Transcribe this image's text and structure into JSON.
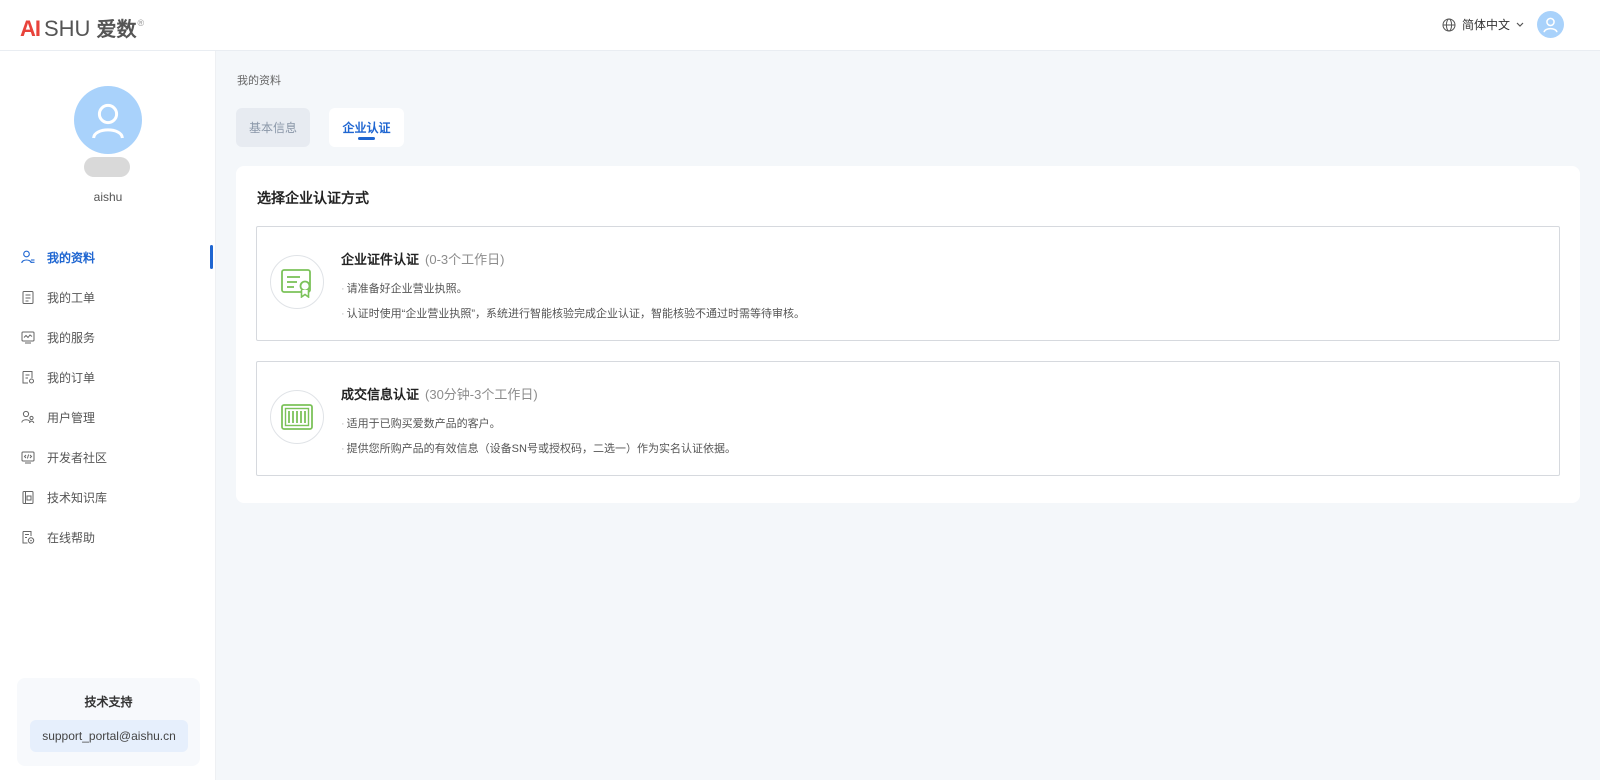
{
  "header": {
    "logo": {
      "ai": "AI",
      "shu": "SHU",
      "cn": "爱数",
      "reg": "®"
    },
    "language": "简体中文"
  },
  "sidebar": {
    "username": "aishu",
    "menu": [
      {
        "label": "我的资料",
        "icon": "user-profile-icon",
        "active": true
      },
      {
        "label": "我的工单",
        "icon": "clipboard-icon",
        "active": false
      },
      {
        "label": "我的服务",
        "icon": "service-monitor-icon",
        "active": false
      },
      {
        "label": "我的订单",
        "icon": "order-document-icon",
        "active": false
      },
      {
        "label": "用户管理",
        "icon": "users-icon",
        "active": false
      },
      {
        "label": "开发者社区",
        "icon": "code-icon",
        "active": false
      },
      {
        "label": "技术知识库",
        "icon": "knowledge-book-icon",
        "active": false
      },
      {
        "label": "在线帮助",
        "icon": "help-document-icon",
        "active": false
      }
    ],
    "support": {
      "title": "技术支持",
      "email": "support_portal@aishu.cn"
    }
  },
  "main": {
    "breadcrumb": "我的资料",
    "tabs": [
      {
        "label": "基本信息",
        "active": false
      },
      {
        "label": "企业认证",
        "active": true
      }
    ],
    "panel_title": "选择企业认证方式",
    "options": [
      {
        "title": "企业证件认证",
        "subtitle": "(0-3个工作日)",
        "icon": "certificate-icon",
        "lines": [
          "请准备好企业营业执照。",
          "认证时使用“企业营业执照”，系统进行智能核验完成企业认证，智能核验不通过时需等待审核。"
        ]
      },
      {
        "title": "成交信息认证",
        "subtitle": "(30分钟-3个工作日)",
        "icon": "barcode-icon",
        "lines": [
          "适用于已购买爱数产品的客户。",
          "提供您所购产品的有效信息（设备SN号或授权码，二选一）作为实名认证依据。"
        ]
      }
    ]
  },
  "colors": {
    "accent": "#1f66d1",
    "avatar": "#a9d2fb",
    "icon_green": "#7cc25a",
    "page_bg": "#f4f7fa"
  }
}
